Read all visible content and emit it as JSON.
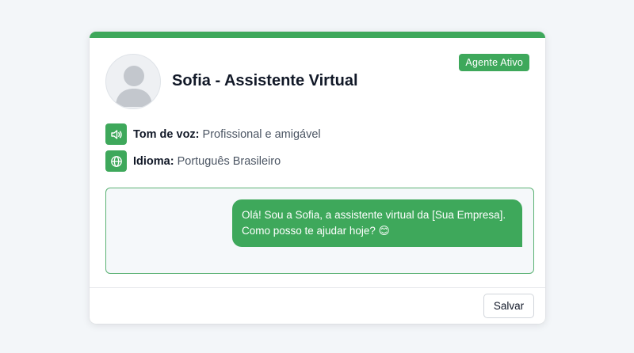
{
  "agent": {
    "name": "Sofia",
    "title_suffix": " - Assistente Virtual",
    "status_badge": "Agente Ativo"
  },
  "info": {
    "tone_label": "Tom de voz:",
    "tone_value": " Profissional e amigável",
    "language_label": "Idioma:",
    "language_value": " Português Brasileiro"
  },
  "chat": {
    "message": "Olá! Sou a Sofia, a assistente virtual da [Sua Empresa]. Como posso te ajudar hoje? 😊"
  },
  "actions": {
    "save_label": "Salvar"
  },
  "icons": {
    "avatar": "user-placeholder-icon",
    "tone": "speaker-icon",
    "language": "globe-icon"
  },
  "colors": {
    "accent": "#3ea85b",
    "page_background": "#f3f6f9"
  }
}
